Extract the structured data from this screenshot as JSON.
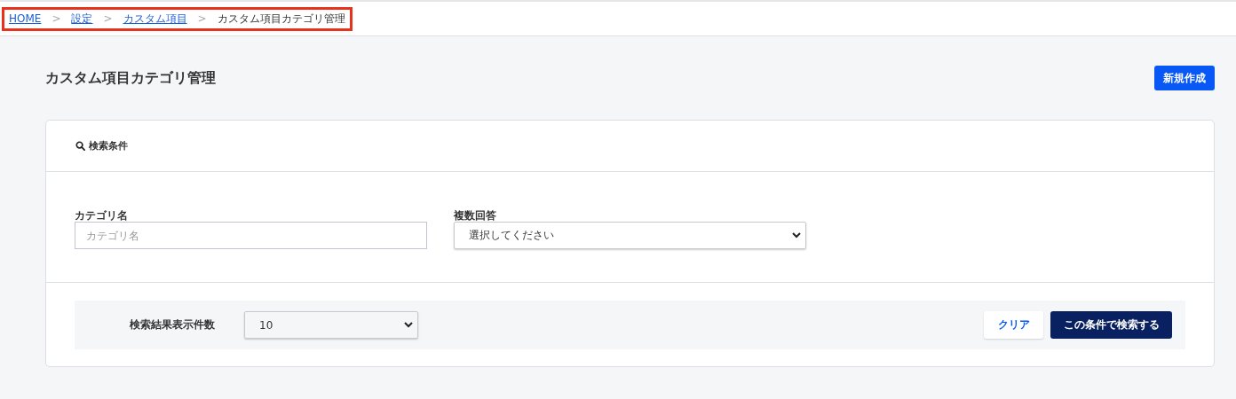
{
  "breadcrumb": [
    {
      "label": "HOME",
      "link": true
    },
    {
      "label": "設定",
      "link": true
    },
    {
      "label": "カスタム項目",
      "link": true
    },
    {
      "label": "カスタム項目カテゴリ管理",
      "link": false
    }
  ],
  "breadcrumb_separator": ">",
  "page_title": "カスタム項目カテゴリ管理",
  "new_button": "新規作成",
  "search_panel": {
    "title": "検索条件",
    "fields": [
      {
        "kind": "text",
        "label": "カテゴリ名",
        "placeholder": "カテゴリ名"
      },
      {
        "kind": "select",
        "label": "複数回答",
        "value": "選択してください"
      }
    ],
    "per_page": {
      "label": "検索結果表示件数",
      "value": "10"
    },
    "clear_button": "クリア",
    "search_button": "この条件で検索する"
  }
}
